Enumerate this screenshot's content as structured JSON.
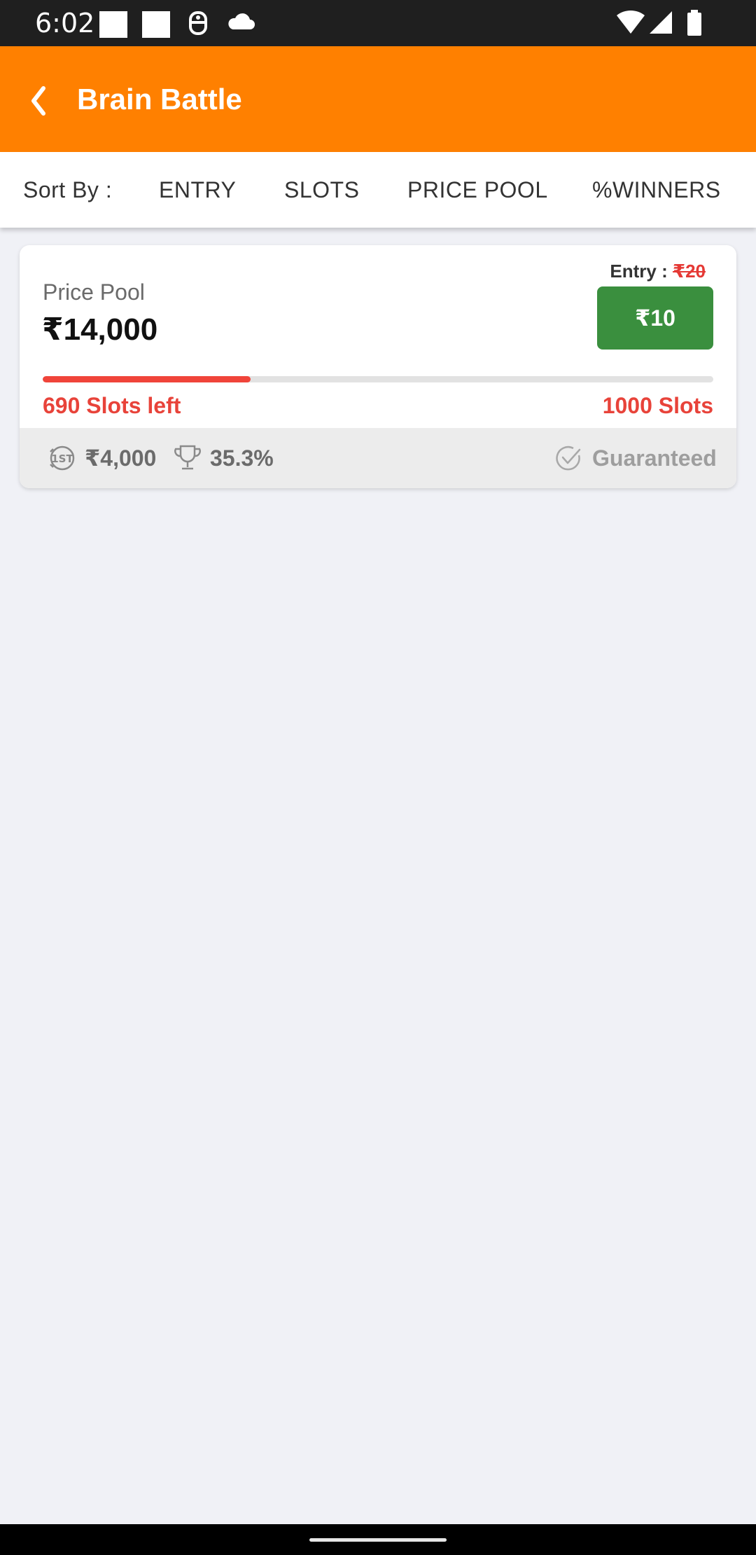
{
  "status_bar": {
    "time": "6:02",
    "icons": [
      "notification-square-icon",
      "notification-square-icon",
      "accessibility-icon",
      "cloud-icon",
      "wifi-icon",
      "signal-icon",
      "battery-icon"
    ]
  },
  "app_bar": {
    "title": "Brain Battle",
    "back_icon": "chevron-left-icon",
    "background": "#ff8000"
  },
  "sort_bar": {
    "label": "Sort By :",
    "options": [
      "ENTRY",
      "SLOTS",
      "PRICE POOL",
      "%WINNERS"
    ]
  },
  "contest": {
    "pool_label": "Price Pool",
    "pool_amount": "₹14,000",
    "entry_label": "Entry : ",
    "entry_original": "₹20",
    "entry_button": "₹10",
    "slots_filled_fraction": 0.31,
    "slots_left": "690 Slots left",
    "slots_total": "1000 Slots",
    "first_prize": "₹4,000",
    "winners_percent": "35.3%",
    "guarantee": "Guaranteed"
  },
  "colors": {
    "accent": "#ff8000",
    "button_green": "#3a8f3e",
    "alert_red": "#e8433a"
  }
}
